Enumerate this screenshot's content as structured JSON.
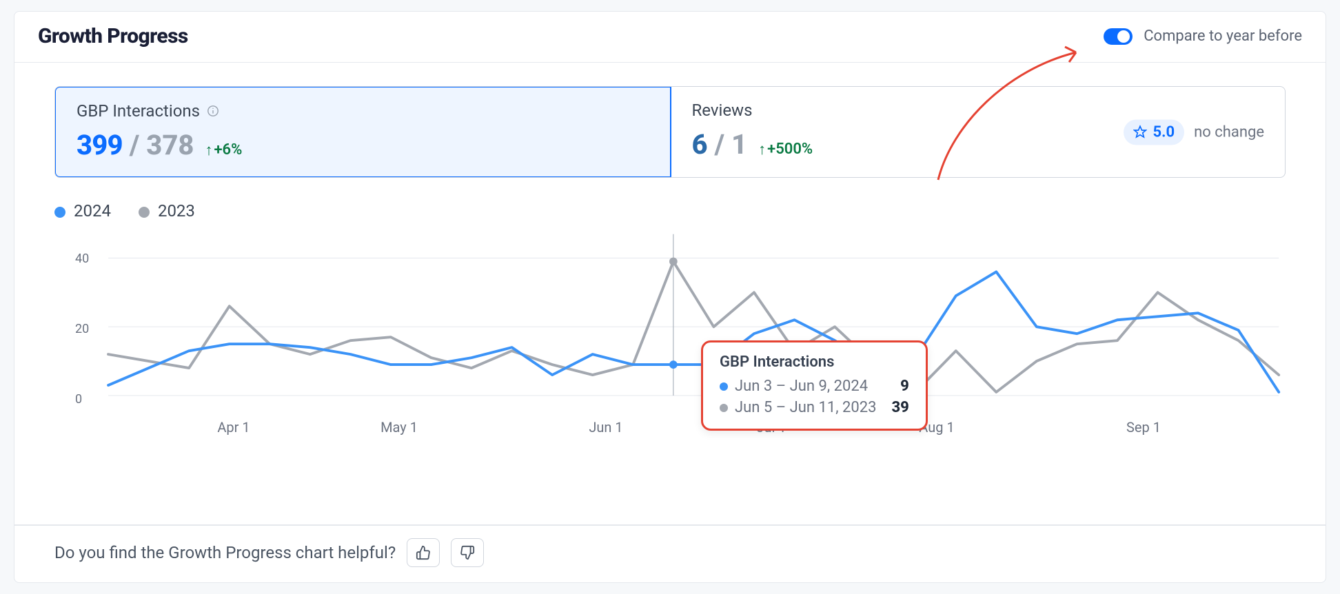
{
  "header": {
    "title": "Growth Progress",
    "compare_label": "Compare to year before",
    "compare_on": true
  },
  "tabs": {
    "gbp": {
      "title": "GBP Interactions",
      "value_current": "399",
      "value_prev": "378",
      "delta": "+6%"
    },
    "reviews": {
      "title": "Reviews",
      "value_current": "6",
      "value_prev": "1",
      "delta": "+500%",
      "rating": "5.0",
      "rating_change": "no change"
    }
  },
  "legend": {
    "current": "2024",
    "prev": "2023"
  },
  "tooltip": {
    "title": "GBP Interactions",
    "row1": {
      "label": "Jun 3 – Jun 9, 2024",
      "value": "9"
    },
    "row2": {
      "label": "Jun 5 – Jun 11, 2023",
      "value": "39"
    }
  },
  "footer": {
    "question": "Do you find the Growth Progress chart helpful?"
  },
  "colors": {
    "blue": "#3b93f7",
    "grey": "#a3a8b0",
    "accent": "#0b6cff",
    "tooltip_border": "#e54333"
  },
  "chart_data": {
    "type": "line",
    "xlabel": "",
    "ylabel": "",
    "yticks": [
      0,
      20,
      40
    ],
    "ylim": [
      0,
      45
    ],
    "xticks": [
      "Apr 1",
      "May 1",
      "Jun 1",
      "Jul 1",
      "Aug 1",
      "Sep 1"
    ],
    "x_month_start_index": [
      3,
      7,
      12,
      16,
      20,
      25
    ],
    "series": [
      {
        "name": "2024",
        "color": "#3b93f7",
        "values": [
          3,
          8,
          13,
          15,
          15,
          14,
          12,
          9,
          9,
          11,
          14,
          6,
          12,
          9,
          9,
          9,
          18,
          22,
          16,
          9,
          11,
          29,
          36,
          20,
          18,
          22,
          23,
          24,
          19,
          1
        ]
      },
      {
        "name": "2023",
        "color": "#a3a8b0",
        "values": [
          12,
          10,
          8,
          26,
          15,
          12,
          16,
          17,
          11,
          8,
          13,
          9,
          6,
          9,
          39,
          20,
          30,
          13,
          20,
          9,
          1,
          13,
          1,
          10,
          15,
          16,
          30,
          22,
          16,
          6
        ]
      }
    ],
    "hover_index": 14
  }
}
